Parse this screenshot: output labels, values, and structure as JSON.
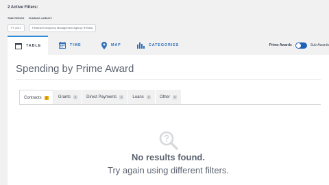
{
  "filters": {
    "title": "2 Active Filters:",
    "groups": [
      {
        "label": "TIME PERIOD",
        "chip": "FY 2017"
      },
      {
        "label": "FUNDING AGENCY",
        "chip": "Federal Emergency Management Agency (FEMA)"
      }
    ]
  },
  "viz_tabs": [
    {
      "label": "TABLE",
      "icon": "table-icon",
      "active": true
    },
    {
      "label": "TIME",
      "icon": "calendar-icon",
      "active": false
    },
    {
      "label": "MAP",
      "icon": "map-marker-icon",
      "active": false
    },
    {
      "label": "CATEGORIES",
      "icon": "bar-chart-icon",
      "active": false
    }
  ],
  "award_toggle": {
    "left_label": "Prime Awards",
    "right_label": "Sub-Awards"
  },
  "section": {
    "title": "Spending by Prime Award"
  },
  "award_tabs": [
    {
      "label": "Contracts",
      "count": "0",
      "active": true
    },
    {
      "label": "Grants",
      "count": "0",
      "active": false
    },
    {
      "label": "Direct Payments",
      "count": "0",
      "active": false
    },
    {
      "label": "Loans",
      "count": "0",
      "active": false
    },
    {
      "label": "Other",
      "count": "0",
      "active": false
    }
  ],
  "empty_state": {
    "icon": "search-question-icon",
    "title": "No results found.",
    "message": "Try again using different filters."
  },
  "colors": {
    "page_background": "#f1f1f1",
    "link_blue": "#2f6fb7",
    "active_tab_border": "#2e89d6",
    "toggle_blue": "#1f61b4",
    "badge_active": "#f2a900",
    "muted_text": "#5c6470"
  }
}
